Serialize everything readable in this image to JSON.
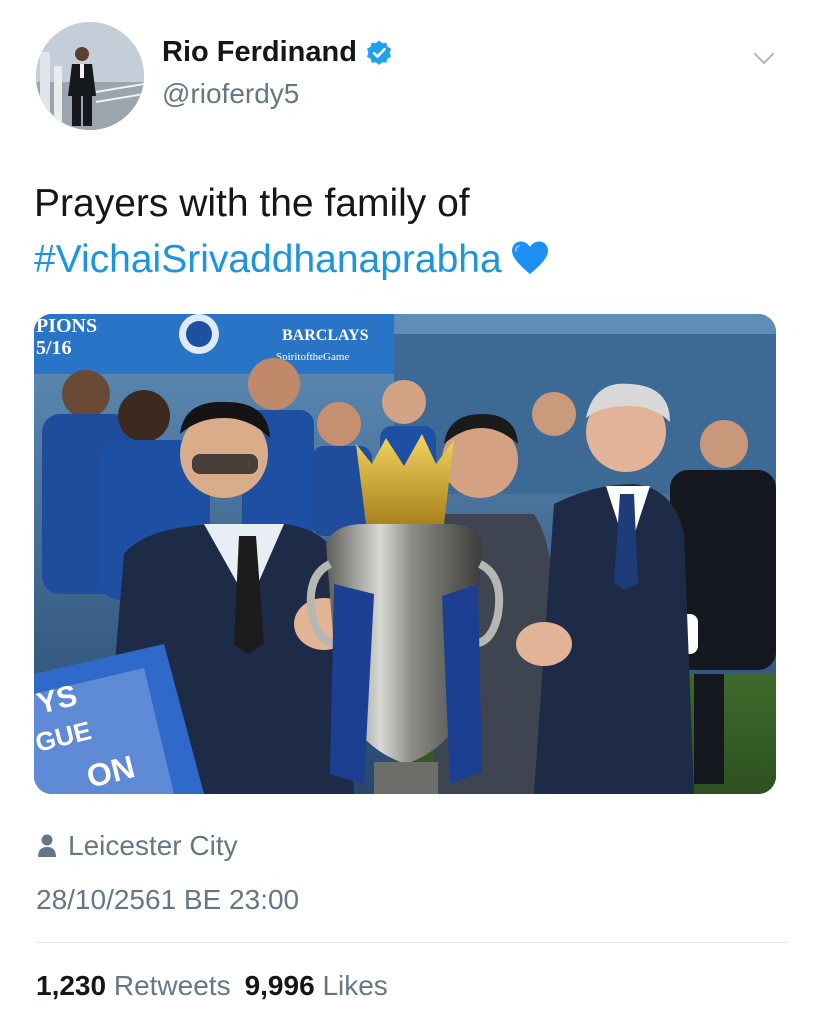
{
  "author": {
    "name": "Rio Ferdinand",
    "handle": "@rioferdy5",
    "verified": true,
    "avatar_icon": "profile-photo"
  },
  "tweet": {
    "text_line": "Prayers with the family of",
    "hashtag": "#VichaiSrivaddhanaprabha",
    "emoji_icon": "blue-heart-icon"
  },
  "media": {
    "banner_left_top": "PIONS",
    "banner_left_bottom": "5/16",
    "sponsor": "BARCLAYS",
    "sponsor_tagline": "SpiritoftheGame",
    "board_text_1": "YS",
    "board_text_2": "GUE",
    "board_text_3": "ON"
  },
  "meta": {
    "location": "Leicester City",
    "timestamp": "28/10/2561 BE 23:00"
  },
  "stats": {
    "retweets_count": "1,230",
    "retweets_label": "Retweets",
    "likes_count": "9,996",
    "likes_label": "Likes"
  },
  "colors": {
    "link_blue": "#1b95e0",
    "verified_blue": "#1da1f2",
    "muted_gray": "#657786",
    "text_dark": "#14171a",
    "leicester_blue": "#1d4fa3"
  }
}
